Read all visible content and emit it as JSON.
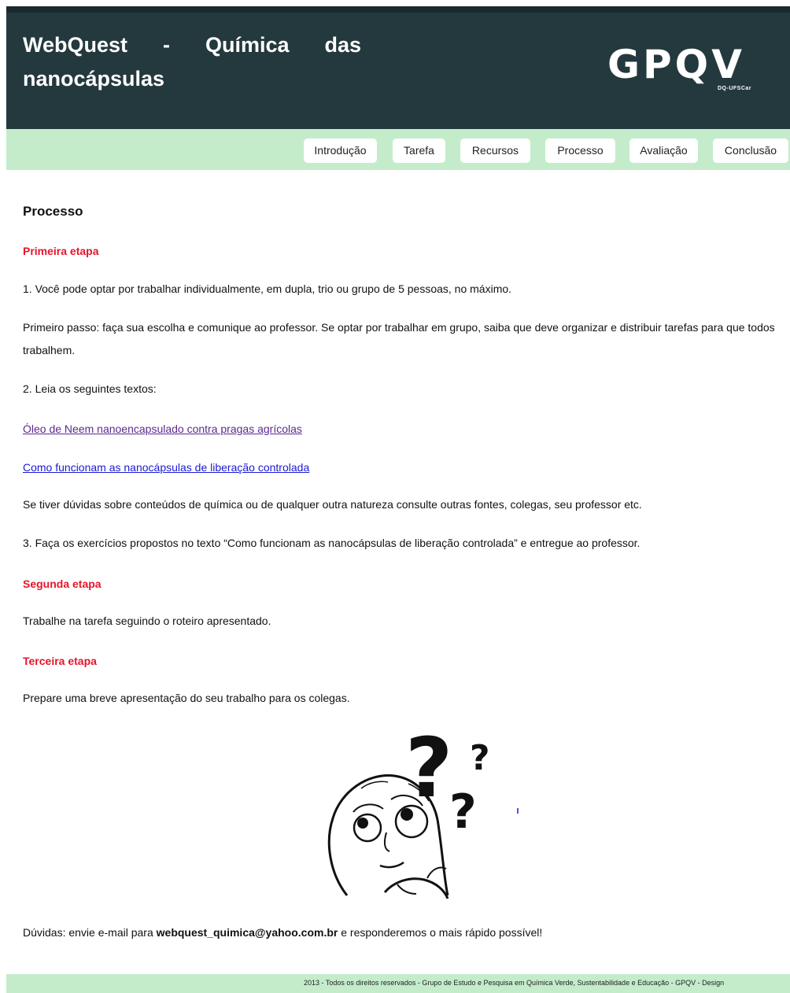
{
  "header": {
    "site_title": "WebQuest - Química das nanocápsulas",
    "logo_text": "GPQV",
    "logo_subtext": "DQ-UFSCar"
  },
  "nav": {
    "items": [
      {
        "label": "Introdução"
      },
      {
        "label": "Tarefa"
      },
      {
        "label": "Recursos"
      },
      {
        "label": "Processo"
      },
      {
        "label": "Avaliação"
      },
      {
        "label": "Conclusão"
      }
    ]
  },
  "content": {
    "heading": "Processo",
    "stage1_title": "Primeira etapa",
    "stage1_p1": "1. Você pode optar por trabalhar individualmente, em dupla, trio ou grupo de 5 pessoas, no máximo.",
    "stage1_p2": "Primeiro passo: faça sua escolha e comunique ao professor. Se optar por trabalhar em grupo, saiba que deve organizar e distribuir tarefas para que todos trabalhem.",
    "stage1_p3": "2. Leia os seguintes textos:",
    "link1": "Óleo de Neem nanoencapsulado contra pragas agrícolas",
    "link2": "Como funcionam as nanocápsulas de liberação controlada",
    "stage1_p4": "Se tiver dúvidas sobre conteúdos de química ou de qualquer outra natureza consulte outras fontes, colegas, seu professor etc.",
    "stage1_p5": "3. Faça os exercícios propostos no texto “Como funcionam as nanocápsulas de liberação controlada” e entregue ao professor.",
    "stage2_title": "Segunda etapa",
    "stage2_p1": "Trabalhe na tarefa seguindo o roteiro apresentado.",
    "stage3_title": "Terceira etapa",
    "stage3_p1": "Prepare uma breve apresentação do seu trabalho para os colegas.",
    "contact_prefix": "Dúvidas: envie e-mail para ",
    "contact_email": "webquest_quimica@yahoo.com.br",
    "contact_suffix": " e responderemos o mais rápido possível!"
  },
  "footer": {
    "text": "2013 - Todos os direitos reservados - Grupo de Estudo e Pesquisa em Química Verde, Sustentabilidade e Educação - GPQV - Design"
  }
}
